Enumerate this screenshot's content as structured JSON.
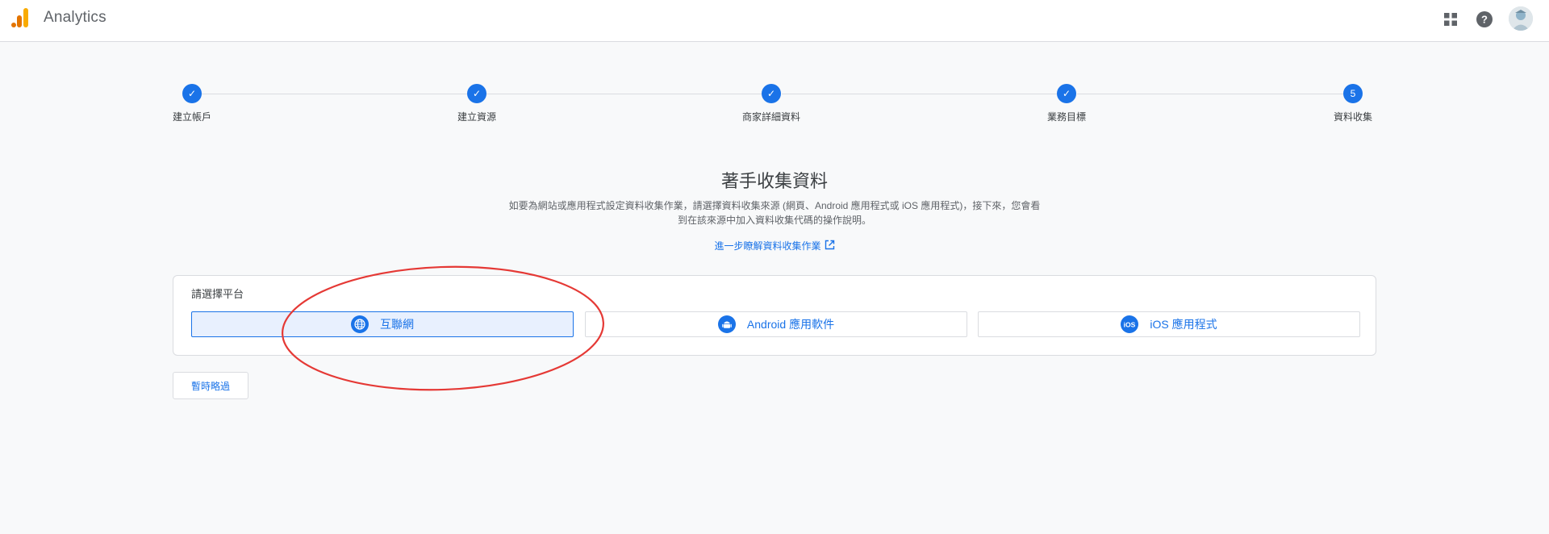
{
  "app": {
    "title": "Analytics",
    "logo_icon": "analytics-logo-icon"
  },
  "header": {
    "apps_icon": "apps-grid-icon",
    "help_icon": "help-icon",
    "avatar_icon": "avatar"
  },
  "stepper": {
    "steps": [
      {
        "label": "建立帳戶",
        "state": "done",
        "marker": "✓"
      },
      {
        "label": "建立資源",
        "state": "done",
        "marker": "✓"
      },
      {
        "label": "商家詳細資料",
        "state": "done",
        "marker": "✓"
      },
      {
        "label": "業務目標",
        "state": "done",
        "marker": "✓"
      },
      {
        "label": "資料收集",
        "state": "current",
        "marker": "5"
      }
    ]
  },
  "main": {
    "title": "著手收集資料",
    "description_line1": "如要為網站或應用程式設定資料收集作業，請選擇資料收集來源 (網頁、Android 應用程式或 iOS 應用程式)，接下來，您會看",
    "description_line2": "到在該來源中加入資料收集代碼的操作說明。",
    "learn_more": "進一步瞭解資料收集作業"
  },
  "platform": {
    "label": "請選擇平台",
    "options": [
      {
        "label": "互聯網",
        "icon": "globe-icon",
        "selected": true
      },
      {
        "label": "Android 應用軟件",
        "icon": "android-icon",
        "selected": false
      },
      {
        "label": "iOS 應用程式",
        "icon": "ios-icon",
        "selected": false
      }
    ]
  },
  "skip_button": "暫時略過",
  "colors": {
    "accent": "#1a73e8",
    "selected_bg": "#e8f0fe",
    "annotation": "#e53935",
    "logo_orange": "#f9ab00",
    "logo_dark_orange": "#e37400"
  }
}
